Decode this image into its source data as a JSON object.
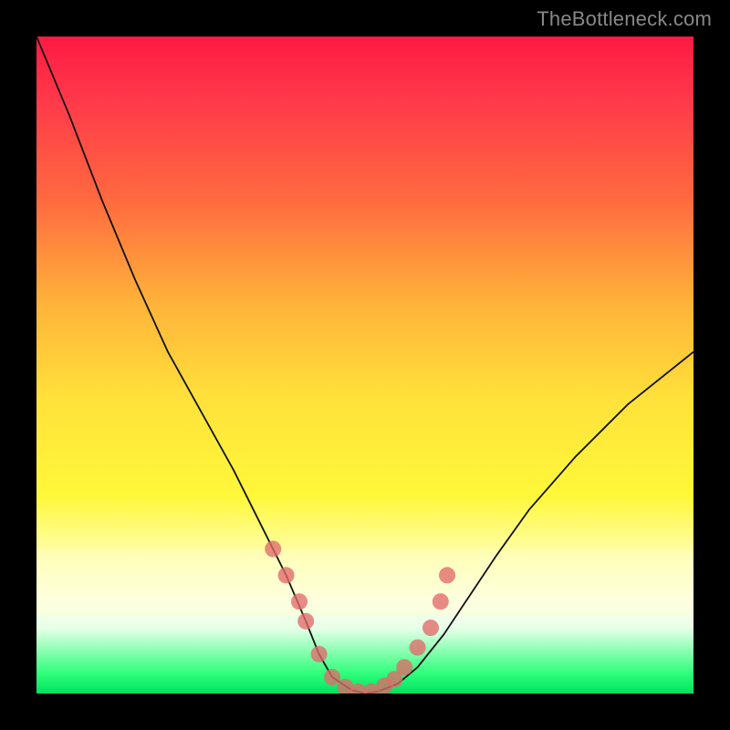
{
  "watermark": "TheBottleneck.com",
  "colors": {
    "gradient_top": "#ff1a44",
    "gradient_mid1": "#ffb03a",
    "gradient_mid2": "#fff83a",
    "gradient_bottom": "#00e060",
    "frame": "#000000",
    "curve": "#111111",
    "dot": "#e06a6a"
  },
  "chart_data": {
    "type": "line",
    "title": "",
    "xlabel": "",
    "ylabel": "",
    "xlim": [
      0,
      100
    ],
    "ylim": [
      0,
      100
    ],
    "series": [
      {
        "name": "bottleneck-curve",
        "x": [
          0,
          5,
          10,
          15,
          20,
          25,
          30,
          34,
          38,
          41,
          43,
          45,
          48,
          50,
          52,
          55,
          58,
          62,
          66,
          70,
          75,
          82,
          90,
          100
        ],
        "values": [
          100,
          88,
          75,
          63,
          52,
          43,
          34,
          26,
          18,
          11,
          6,
          2.5,
          0.5,
          0,
          0.3,
          1.5,
          4,
          9,
          15,
          21,
          28,
          36,
          44,
          52
        ]
      }
    ],
    "points": {
      "name": "highlight-dots",
      "x": [
        36,
        38,
        40,
        41,
        43,
        45,
        47,
        49,
        51,
        53,
        54.5,
        56,
        58,
        60,
        61.5,
        62.5
      ],
      "values": [
        22,
        18,
        14,
        11,
        6,
        2.5,
        1,
        0.3,
        0.3,
        1.2,
        2.2,
        4,
        7,
        10,
        14,
        18
      ]
    }
  }
}
